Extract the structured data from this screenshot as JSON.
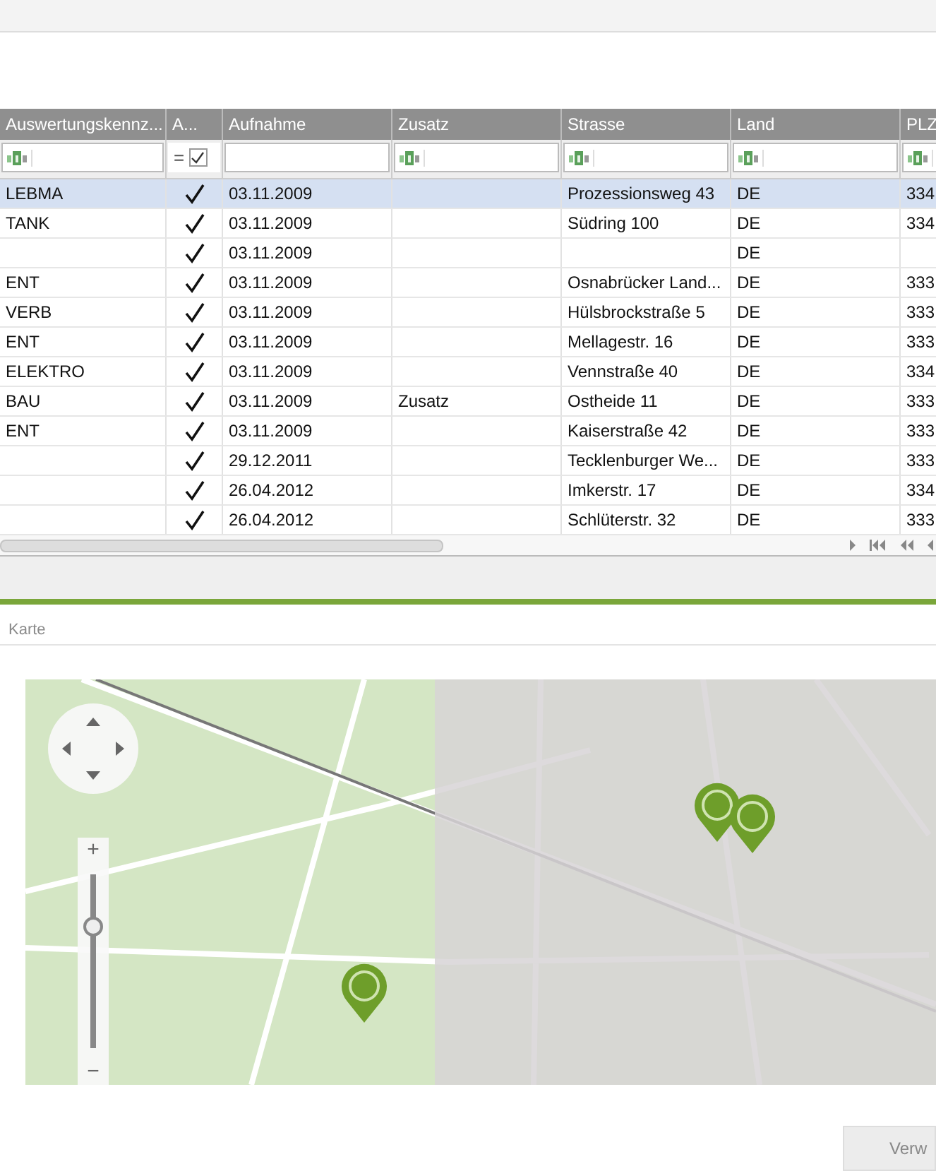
{
  "table": {
    "columns": [
      {
        "label": "Auswertungskennz...",
        "kind": "text"
      },
      {
        "label": "A...",
        "kind": "bool"
      },
      {
        "label": "Aufnahme",
        "kind": "none"
      },
      {
        "label": "Zusatz",
        "kind": "text"
      },
      {
        "label": "Strasse",
        "kind": "text"
      },
      {
        "label": "Land",
        "kind": "text"
      },
      {
        "label": "PLZ",
        "kind": "text"
      }
    ],
    "filter_bool": {
      "operator": "=",
      "checked": true
    },
    "rows": [
      {
        "selected": true,
        "checked": true,
        "cells": [
          "LEBMA",
          "",
          "03.11.2009",
          "",
          "Prozessionsweg 43",
          "DE",
          "334"
        ]
      },
      {
        "selected": false,
        "checked": true,
        "cells": [
          "TANK",
          "",
          "03.11.2009",
          "",
          "Südring 100",
          "DE",
          "334"
        ]
      },
      {
        "selected": false,
        "checked": true,
        "cells": [
          "",
          "",
          "03.11.2009",
          "",
          "",
          "DE",
          ""
        ]
      },
      {
        "selected": false,
        "checked": true,
        "cells": [
          "ENT",
          "",
          "03.11.2009",
          "",
          "Osnabrücker Land...",
          "DE",
          "333"
        ]
      },
      {
        "selected": false,
        "checked": true,
        "cells": [
          "VERB",
          "",
          "03.11.2009",
          "",
          "Hülsbrockstraße 5",
          "DE",
          "333"
        ]
      },
      {
        "selected": false,
        "checked": true,
        "cells": [
          "ENT",
          "",
          "03.11.2009",
          "",
          "Mellagestr. 16",
          "DE",
          "333"
        ]
      },
      {
        "selected": false,
        "checked": true,
        "cells": [
          "ELEKTRO",
          "",
          "03.11.2009",
          "",
          "Vennstraße 40",
          "DE",
          "334"
        ]
      },
      {
        "selected": false,
        "checked": true,
        "cells": [
          "BAU",
          "",
          "03.11.2009",
          "Zusatz",
          "Ostheide 11",
          "DE",
          "333"
        ]
      },
      {
        "selected": false,
        "checked": true,
        "cells": [
          "ENT",
          "",
          "03.11.2009",
          "",
          "Kaiserstraße 42",
          "DE",
          "333"
        ]
      },
      {
        "selected": false,
        "checked": true,
        "cells": [
          "",
          "",
          "29.12.2011",
          "",
          "Tecklenburger We...",
          "DE",
          "333"
        ]
      },
      {
        "selected": false,
        "checked": true,
        "cells": [
          "",
          "",
          "26.04.2012",
          "",
          "Imkerstr. 17",
          "DE",
          "334"
        ]
      },
      {
        "selected": false,
        "checked": true,
        "cells": [
          "",
          "",
          "26.04.2012",
          "",
          "Schlüterstr. 32",
          "DE",
          "333"
        ]
      }
    ]
  },
  "map_panel": {
    "title": "Karte",
    "zoom": {
      "plus": "+",
      "minus": "−",
      "level": 0.71
    }
  },
  "button": {
    "label": "Verw"
  }
}
